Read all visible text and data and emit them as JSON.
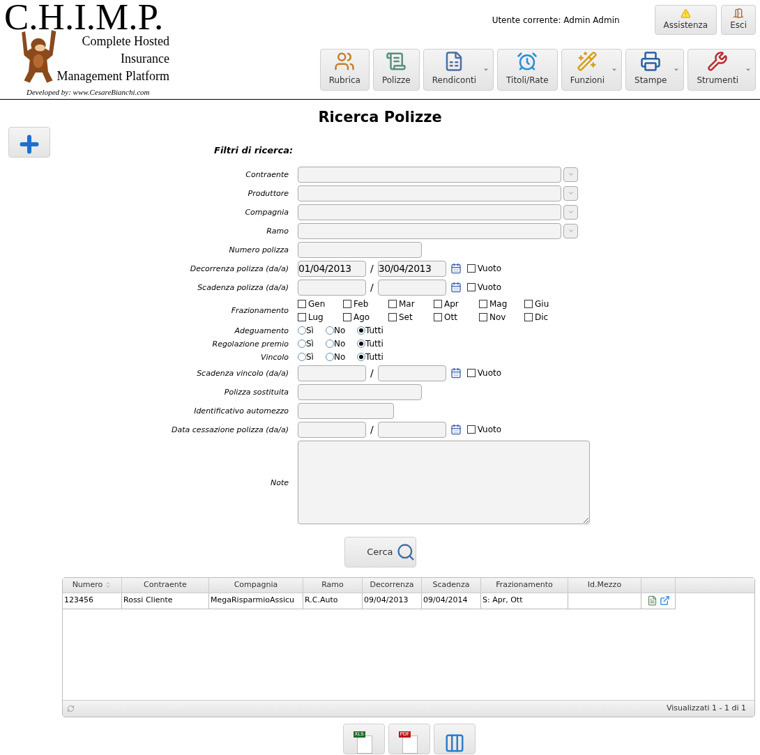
{
  "logo": {
    "title": "C.H.I.M.P.",
    "lines": [
      "Complete Hosted",
      "Insurance",
      "Management Platform"
    ],
    "credit": "Developed by: www.CesareBianchi.com"
  },
  "user": "Utente corrente: Admin Admin",
  "top_buttons": [
    {
      "label": "Assistenza"
    },
    {
      "label": "Esci"
    }
  ],
  "nav": [
    {
      "label": "Rubrica",
      "dropdown": false
    },
    {
      "label": "Polizze",
      "dropdown": false
    },
    {
      "label": "Rendiconti",
      "dropdown": true
    },
    {
      "label": "Titoli/Rate",
      "dropdown": false
    },
    {
      "label": "Funzioni",
      "dropdown": true
    },
    {
      "label": "Stampe",
      "dropdown": true
    },
    {
      "label": "Strumenti",
      "dropdown": true
    }
  ],
  "title": "Ricerca Polizze",
  "filters_heading": "Filtri di ricerca:",
  "form": {
    "rows": [
      {
        "kind": "combo",
        "label": "Contraente"
      },
      {
        "kind": "combo",
        "label": "Produttore"
      },
      {
        "kind": "combo",
        "label": "Compagnia"
      },
      {
        "kind": "combo",
        "label": "Ramo"
      },
      {
        "kind": "text",
        "label": "Numero polizza"
      },
      {
        "kind": "daterange",
        "label": "Decorrenza polizza (da/a)",
        "from": "01/04/2013",
        "separator": "/",
        "to": "30/04/2013",
        "empty_label": "Vuoto",
        "empty_checked": false
      },
      {
        "kind": "daterange",
        "label": "Scadenza polizza (da/a)",
        "separator": "/",
        "empty_label": "Vuoto",
        "empty_checked": false
      },
      {
        "kind": "months",
        "label": "Frazionamento",
        "options": [
          {
            "label": "Gen",
            "checked": false
          },
          {
            "label": "Feb",
            "checked": false
          },
          {
            "label": "Mar",
            "checked": false
          },
          {
            "label": "Apr",
            "checked": false
          },
          {
            "label": "Mag",
            "checked": false
          },
          {
            "label": "Giu",
            "checked": false
          },
          {
            "label": "Lug",
            "checked": false
          },
          {
            "label": "Ago",
            "checked": false
          },
          {
            "label": "Set",
            "checked": false
          },
          {
            "label": "Ott",
            "checked": false
          },
          {
            "label": "Nov",
            "checked": false
          },
          {
            "label": "Dic",
            "checked": false
          }
        ]
      },
      {
        "kind": "radio",
        "label": "Adeguamento",
        "options": [
          {
            "label": "Sì",
            "selected": false
          },
          {
            "label": "No",
            "selected": false
          },
          {
            "label": "Tutti",
            "selected": true
          }
        ]
      },
      {
        "kind": "radio",
        "label": "Regolazione premio",
        "options": [
          {
            "label": "Sì",
            "selected": false
          },
          {
            "label": "No",
            "selected": false
          },
          {
            "label": "Tutti",
            "selected": true
          }
        ]
      },
      {
        "kind": "radio",
        "label": "Vincolo",
        "options": [
          {
            "label": "Sì",
            "selected": false
          },
          {
            "label": "No",
            "selected": false
          },
          {
            "label": "Tutti",
            "selected": true
          }
        ]
      },
      {
        "kind": "daterange",
        "label": "Scadenza vincolo (da/a)",
        "separator": "/",
        "empty_label": "Vuoto",
        "empty_checked": false
      },
      {
        "kind": "text",
        "label": "Polizza sostituita"
      },
      {
        "kind": "shorttext",
        "label": "Identificativo automezzo"
      },
      {
        "kind": "daterange",
        "label": "Data cessazione polizza (da/a)",
        "separator": "/",
        "empty_label": "Vuoto",
        "empty_checked": false
      },
      {
        "kind": "textarea",
        "label": "Note"
      }
    ]
  },
  "search_button": "Cerca",
  "table": {
    "columns": [
      {
        "label": "Numero",
        "sort": true
      },
      {
        "label": "Contraente",
        "sort": false
      },
      {
        "label": "Compagnia",
        "sort": false
      },
      {
        "label": "Ramo",
        "sort": false
      },
      {
        "label": "Decorrenza",
        "sort": false
      },
      {
        "label": "Scadenza",
        "sort": false
      },
      {
        "label": "Frazionamento",
        "sort": false
      },
      {
        "label": "Id.Mezzo",
        "sort": false
      }
    ],
    "rows": [
      {
        "cells": [
          "123456",
          "Rossi Cliente",
          "MegaRisparmioAssicu",
          "R.C.Auto",
          "09/04/2013",
          "09/04/2014",
          "S: Apr, Ott",
          ""
        ]
      }
    ],
    "status": "Visualizzati 1 - 1 di 1"
  },
  "export_buttons": [
    {
      "kind": "xls",
      "badge": "XLS"
    },
    {
      "kind": "pdf",
      "badge": "PDF"
    },
    {
      "kind": "columns"
    }
  ]
}
